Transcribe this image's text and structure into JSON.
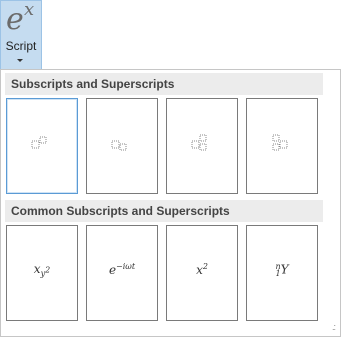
{
  "ribbon": {
    "icon_base": "e",
    "icon_sup": "x",
    "label": "Script"
  },
  "gallery": {
    "sections": [
      {
        "title": "Subscripts and Superscripts",
        "items": [
          {
            "name": "superscript-template",
            "icon": "superscript-template-icon"
          },
          {
            "name": "subscript-template",
            "icon": "subscript-template-icon"
          },
          {
            "name": "sub-superscript-template",
            "icon": "sub-superscript-template-icon"
          },
          {
            "name": "left-sub-superscript-template",
            "icon": "left-sub-superscript-template-icon"
          }
        ]
      },
      {
        "title": "Common Subscripts and Superscripts",
        "items": [
          {
            "name": "x-sub-y-squared",
            "base": "x",
            "sub": "y",
            "subsup": "2"
          },
          {
            "name": "e-minus-i-omega-t",
            "base": "e",
            "sup": "−iωt"
          },
          {
            "name": "x-squared",
            "base": "x",
            "sup": "2"
          },
          {
            "name": "n-one-y",
            "presup": "n",
            "presub": "1",
            "base": "Y"
          }
        ]
      }
    ]
  },
  "colors": {
    "ribbon_bg": "#c5dcf0",
    "selected_border": "#5b9bd5",
    "placeholder": "#8a8a8a"
  }
}
